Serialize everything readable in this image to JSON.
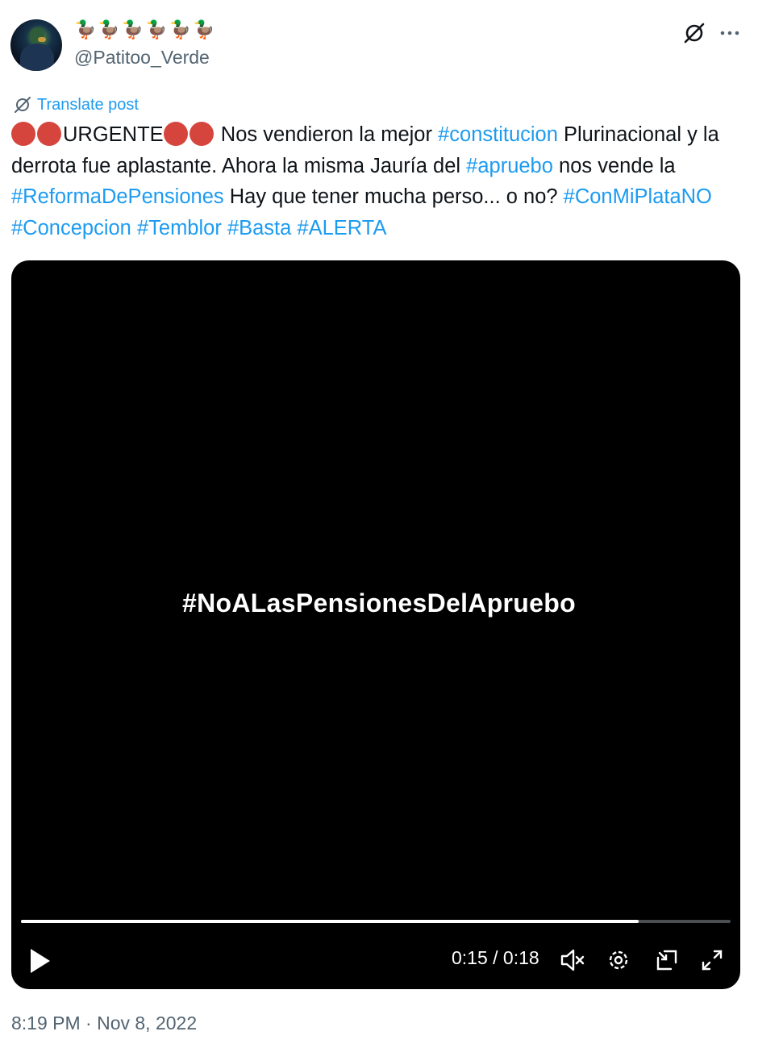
{
  "author": {
    "display_name": "🦆🦆🦆🦆🦆🦆",
    "handle": "@Patitoo_Verde"
  },
  "translate_label": "Translate post",
  "tweet": {
    "segments": [
      {
        "type": "emoji",
        "name": "red-circle"
      },
      {
        "type": "emoji",
        "name": "red-circle"
      },
      {
        "type": "text",
        "text": "URGENTE"
      },
      {
        "type": "emoji",
        "name": "red-circle"
      },
      {
        "type": "emoji",
        "name": "red-circle"
      },
      {
        "type": "text",
        "text": " Nos vendieron la mejor "
      },
      {
        "type": "hashtag",
        "text": "#constitucion"
      },
      {
        "type": "text",
        "text": " Plurinacional y la derrota fue aplastante. Ahora la misma Jauría del "
      },
      {
        "type": "hashtag",
        "text": "#apruebo"
      },
      {
        "type": "text",
        "text": " nos vende la "
      },
      {
        "type": "hashtag",
        "text": "#ReformaDePensiones"
      },
      {
        "type": "text",
        "text": " Hay que tener mucha perso... o no? "
      },
      {
        "type": "hashtag",
        "text": "#ConMiPlataNO"
      },
      {
        "type": "text",
        "text": " "
      },
      {
        "type": "hashtag",
        "text": "#Concepcion"
      },
      {
        "type": "text",
        "text": " "
      },
      {
        "type": "hashtag",
        "text": "#Temblor"
      },
      {
        "type": "text",
        "text": " "
      },
      {
        "type": "hashtag",
        "text": "#Basta"
      },
      {
        "type": "text",
        "text": " "
      },
      {
        "type": "hashtag",
        "text": "#ALERTA"
      }
    ]
  },
  "video": {
    "overlay_text": "#NoALasPensionesDelApruebo",
    "time_display": "0:15 / 0:18",
    "progress_fraction": 0.87
  },
  "icons": {
    "grok": "grok-icon",
    "more": "more-icon",
    "translate": "translate-icon",
    "play": "play-icon",
    "mute": "mute-icon",
    "settings": "settings-icon",
    "pip": "picture-in-picture-icon",
    "fullscreen": "fullscreen-icon"
  },
  "colors": {
    "link": "#1d9bf0",
    "emoji_red": "#d6453d",
    "secondary_text": "#536471"
  },
  "timestamp": "8:19 PM · Nov 8, 2022"
}
